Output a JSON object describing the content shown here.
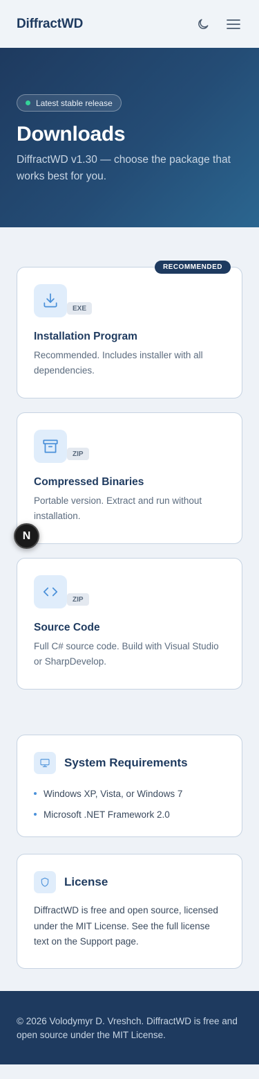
{
  "header": {
    "brand": "DiffractWD",
    "theme_toggle_icon": "moon-icon",
    "menu_icon": "hamburger-menu-icon"
  },
  "hero": {
    "pill_text": "Latest stable release",
    "title": "Downloads",
    "subtitle": "DiffractWD v1.30 — choose the package that works best for you."
  },
  "downloads": [
    {
      "badge": "RECOMMENDED",
      "icon": "download-icon",
      "ext": "EXE",
      "title": "Installation Program",
      "description": "Recommended. Includes installer with all dependencies."
    },
    {
      "icon": "archive-icon",
      "ext": "ZIP",
      "title": "Compressed Binaries",
      "description": "Portable version. Extract and run without installation."
    },
    {
      "icon": "code-icon",
      "ext": "ZIP",
      "title": "Source Code",
      "description": "Full C# source code. Build with Visual Studio or SharpDevelop."
    }
  ],
  "requirements": {
    "icon": "monitor-icon",
    "title": "System Requirements",
    "items": [
      "Windows XP, Vista, or Windows 7",
      "Microsoft .NET Framework 2.0"
    ]
  },
  "license": {
    "icon": "shield-icon",
    "title": "License",
    "text": "DiffractWD is free and open source, licensed under the MIT License. See the full license text on the Support page."
  },
  "footer": {
    "text": "© 2026 Volodymyr D. Vreshch. DiffractWD is free and open source under the MIT License."
  },
  "overlay_badge": {
    "letter": "N"
  },
  "colors": {
    "primary": "#1e3a5f",
    "accent": "#4a90d9",
    "status_dot": "#34d399",
    "page_bg": "#eef2f7"
  }
}
